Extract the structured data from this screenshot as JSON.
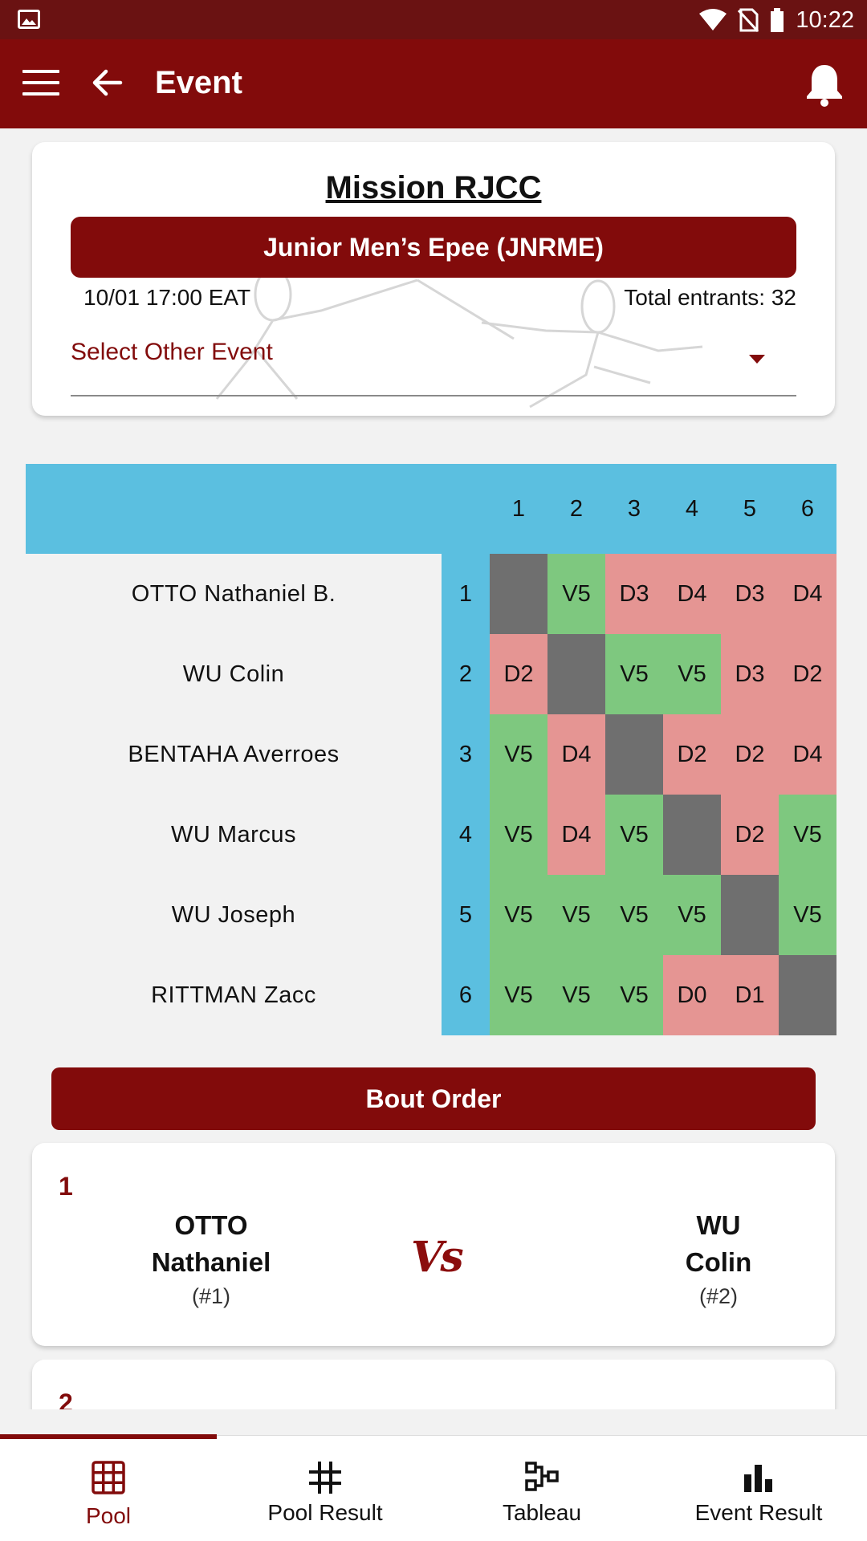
{
  "status_bar": {
    "time": "10:22"
  },
  "app_bar": {
    "title": "Event"
  },
  "event": {
    "name": "Mission RJCC",
    "competition": "Junior Men’s Epee (JNRME)",
    "datetime": "10/01 17:00 EAT",
    "entrants": "Total entrants: 32",
    "select_placeholder": "Select Other Event"
  },
  "pool": {
    "columns": [
      "1",
      "2",
      "3",
      "4",
      "5",
      "6"
    ],
    "rows": [
      {
        "num": "1",
        "name": "OTTO Nathaniel B.",
        "cells": [
          "",
          "V5",
          "D3",
          "D4",
          "D3",
          "D4"
        ]
      },
      {
        "num": "2",
        "name": "WU Colin",
        "cells": [
          "D2",
          "",
          "V5",
          "V5",
          "D3",
          "D2"
        ]
      },
      {
        "num": "3",
        "name": "BENTAHA Averroes",
        "cells": [
          "V5",
          "D4",
          "",
          "D2",
          "D2",
          "D4"
        ]
      },
      {
        "num": "4",
        "name": "WU Marcus",
        "cells": [
          "V5",
          "D4",
          "V5",
          "",
          "D2",
          "V5"
        ]
      },
      {
        "num": "5",
        "name": "WU Joseph",
        "cells": [
          "V5",
          "V5",
          "V5",
          "V5",
          "",
          "V5"
        ]
      },
      {
        "num": "6",
        "name": "RITTMAN Zacc",
        "cells": [
          "V5",
          "V5",
          "V5",
          "D0",
          "D1",
          ""
        ]
      }
    ]
  },
  "bout_order": {
    "label": "Bout Order",
    "vs_label": "Vs",
    "bouts": [
      {
        "number": "1",
        "left": {
          "last": "OTTO",
          "first": "Nathaniel",
          "seed": "(#1)"
        },
        "right": {
          "last": "WU",
          "first": "Colin",
          "seed": "(#2)"
        }
      },
      {
        "number": "2"
      }
    ]
  },
  "bottom_nav": {
    "items": [
      {
        "label": "Pool",
        "icon": "grid-icon",
        "active": true
      },
      {
        "label": "Pool Result",
        "icon": "hash-icon",
        "active": false
      },
      {
        "label": "Tableau",
        "icon": "bracket-icon",
        "active": false
      },
      {
        "label": "Event Result",
        "icon": "bar-chart-icon",
        "active": false
      }
    ]
  },
  "colors": {
    "primary": "#820b0b",
    "status_bar": "#6a1212",
    "pool_header": "#5bbfe0",
    "victory": "#7ec87f",
    "defeat": "#e59593",
    "self": "#6f6f6f"
  }
}
